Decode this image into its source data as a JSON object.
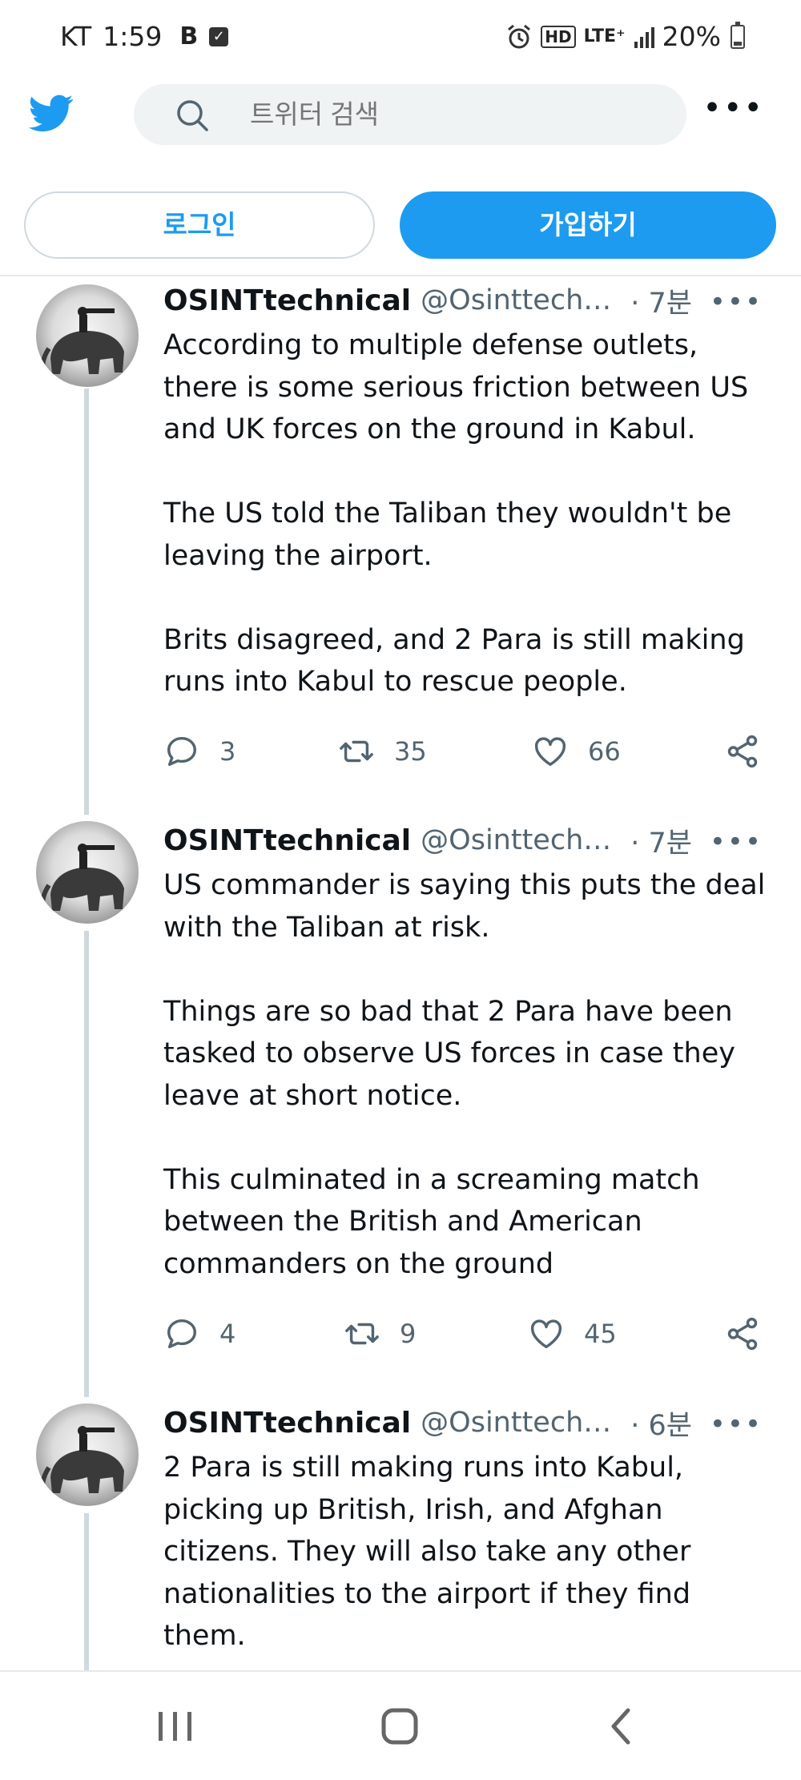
{
  "status_bar": {
    "carrier": "KT",
    "time": "1:59",
    "icon_b": "B",
    "check_icon": "check-square-icon",
    "alarm_icon": "alarm-icon",
    "hd_label": "HD",
    "network_label": "LTE⁺",
    "signal_icon": "signal-bars-icon",
    "battery_percent": "20%",
    "battery_icon": "battery-icon"
  },
  "header": {
    "logo_icon": "twitter-bird-icon",
    "brand_color": "#1d9bf0",
    "search_placeholder": "트위터 검색",
    "search_icon": "search-icon",
    "more_icon": "more-horizontal-icon",
    "login_label": "로그인",
    "signup_label": "가입하기"
  },
  "tweets": [
    {
      "name": "OSINTtechnical",
      "handle": "@Osinttechni...",
      "time": "· 7분",
      "paragraphs": [
        "According to multiple defense outlets, there is some serious friction between US and UK forces on the ground in Kabul.",
        "The US told the Taliban they wouldn't be leaving the airport.",
        "Brits disagreed, and 2 Para is still making runs into Kabul to rescue people."
      ],
      "replies": "3",
      "retweets": "35",
      "likes": "66"
    },
    {
      "name": "OSINTtechnical",
      "handle": "@Osinttechni...",
      "time": "· 7분",
      "paragraphs": [
        "US commander is saying this puts the deal with the Taliban at risk.",
        "Things are so bad that 2 Para have been tasked to observe US forces in case they leave at short notice.",
        "This culminated in a screaming match between the British and American commanders on the ground"
      ],
      "replies": "4",
      "retweets": "9",
      "likes": "45"
    },
    {
      "name": "OSINTtechnical",
      "handle": "@Osinttechni...",
      "time": "· 6분",
      "paragraphs": [
        "2 Para is still making runs into Kabul, picking up British, Irish, and Afghan citizens. They will also take any other nationalities to the airport if they find them."
      ]
    }
  ],
  "nav": {
    "recent_icon": "recent-apps-icon",
    "home_icon": "home-icon",
    "back_icon": "back-icon"
  }
}
